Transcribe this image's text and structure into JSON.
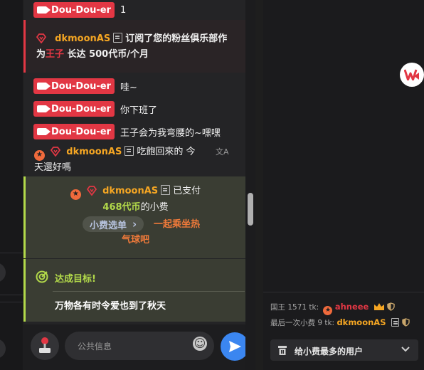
{
  "chat": {
    "messages_top": [
      {
        "user": "Dou-Dou-er",
        "text": "1"
      }
    ],
    "subscription": {
      "user": "dkmoonAS",
      "line1": "订阅了您的粉丝俱乐部作",
      "line2_prefix": "为",
      "tier": "王子",
      "line2_mid": " 长达 ",
      "amount": "500代币",
      "line2_suffix": "/个月"
    },
    "messages_mid": [
      {
        "user": "Dou-Dou-er",
        "text": "哇~"
      },
      {
        "user": "Dou-Dou-er",
        "text": "你下班了"
      },
      {
        "user": "Dou-Dou-er",
        "text": "王子会为我弯腰的~嘿嘿"
      }
    ],
    "translated": {
      "user": "dkmoonAS",
      "line1": "吃飽回來的 今",
      "line2": "天還好嗎",
      "translate_icon": "文A"
    },
    "tip": {
      "user": "dkmoonAS",
      "paid": "已支付",
      "amount": "468代币",
      "suffix": "的小费",
      "menu_button": "小费选单",
      "chevron": "›",
      "action_line1": "一起乘坐热",
      "action_line2": "气球吧"
    },
    "goal": {
      "title": "达成目标!",
      "text": "万物各有时令爱也到了秋天"
    },
    "input": {
      "placeholder": "公共信息",
      "emoji": "☺"
    }
  },
  "right_panel": {
    "king_label": "国王 1571 tk:",
    "king_user": "ahneee",
    "last_tip_label": "最后一次小费 9 tk:",
    "last_tip_user": "dkmoonAS",
    "top_tipper_label": "给小费最多的用户"
  },
  "colors": {
    "badge_red": "#e23744",
    "gold": "#f5a623",
    "green": "#b2d94a",
    "orange": "#f07a3a"
  }
}
